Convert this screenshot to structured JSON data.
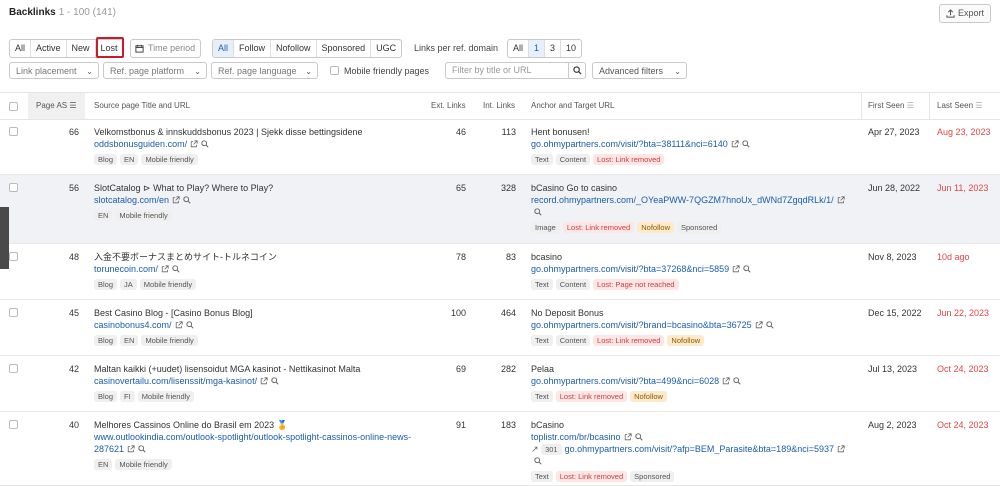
{
  "header": {
    "title": "Backlinks",
    "count": "1 - 100 (141)",
    "export_label": "Export"
  },
  "filters": {
    "status": [
      {
        "label": "All",
        "sel": false
      },
      {
        "label": "Active",
        "sel": false
      },
      {
        "label": "New",
        "sel": false
      },
      {
        "label": "Lost",
        "sel": false
      }
    ],
    "time_period": "Time period",
    "follow": [
      {
        "label": "All",
        "sel": true
      },
      {
        "label": "Follow",
        "sel": false
      },
      {
        "label": "Nofollow",
        "sel": false
      },
      {
        "label": "Sponsored",
        "sel": false
      },
      {
        "label": "UGC",
        "sel": false
      }
    ],
    "links_per_domain_label": "Links per ref. domain",
    "links_per_domain": [
      {
        "label": "All",
        "sel": false
      },
      {
        "label": "1",
        "sel": true
      },
      {
        "label": "3",
        "sel": false
      },
      {
        "label": "10",
        "sel": false
      }
    ],
    "link_placement": "Link placement",
    "ref_page_platform": "Ref. page platform",
    "ref_page_language": "Ref. page language",
    "mobile_friendly_pages": "Mobile friendly pages",
    "search_placeholder": "Filter by title or URL",
    "advanced_filters": "Advanced filters"
  },
  "columns": {
    "page_as": "Page AS",
    "source": "Source page Title and URL",
    "ext": "Ext. Links",
    "int": "Int. Links",
    "anchor": "Anchor and Target URL",
    "first_seen": "First Seen",
    "last_seen": "Last Seen"
  },
  "rows": [
    {
      "as": "66",
      "title": "Velkomstbonus & innskuddsbonus 2023 | Sjekk disse bettingsidene",
      "url": "oddsbonusguiden.com/",
      "tags": [
        "Blog",
        "EN",
        "Mobile friendly"
      ],
      "ext": "46",
      "int": "113",
      "anchor": "Hent bonusen!",
      "target": "go.ohmypartners.com/visit/?bta=38111&nci=6140",
      "atags": [
        {
          "t": "Text",
          "k": ""
        },
        {
          "t": "Content",
          "k": ""
        },
        {
          "t": "Lost: Link removed",
          "k": "lost"
        }
      ],
      "first": "Apr 27, 2023",
      "last": "Aug 23, 2023"
    },
    {
      "as": "56",
      "title": "SlotCatalog ⊳ What to Play? Where to Play?",
      "url": "slotcatalog.com/en",
      "tags": [
        "EN",
        "Mobile friendly"
      ],
      "ext": "65",
      "int": "328",
      "anchor": "bCasino Go to casino",
      "target": "record.ohmypartners.com/_OYeaPWW-7QGZM7hnoUx_dWNd7ZgqdRLk/1/",
      "atags": [
        {
          "t": "Image",
          "k": ""
        },
        {
          "t": "Lost: Link removed",
          "k": "lost"
        },
        {
          "t": "Nofollow",
          "k": "nf"
        },
        {
          "t": "Sponsored",
          "k": ""
        }
      ],
      "first": "Jun 28, 2022",
      "last": "Jun 11, 2023"
    },
    {
      "as": "48",
      "title": "入金不要ボーナスまとめサイト-トルネコイン",
      "url": "torunecoin.com/",
      "tags": [
        "Blog",
        "JA",
        "Mobile friendly"
      ],
      "ext": "78",
      "int": "83",
      "anchor": "bcasino",
      "target": "go.ohmypartners.com/visit/?bta=37268&nci=5859",
      "atags": [
        {
          "t": "Text",
          "k": ""
        },
        {
          "t": "Content",
          "k": ""
        },
        {
          "t": "Lost: Page not reached",
          "k": "lost"
        }
      ],
      "first": "Nov 8, 2023",
      "last": "10d ago"
    },
    {
      "as": "45",
      "title": "Best Casino Blog - [Casino Bonus Blog]",
      "url": "casinobonus4.com/",
      "tags": [
        "Blog",
        "EN",
        "Mobile friendly"
      ],
      "ext": "100",
      "int": "464",
      "anchor": "No Deposit Bonus",
      "target": "go.ohmypartners.com/visit/?brand=bcasino&bta=36725",
      "atags": [
        {
          "t": "Text",
          "k": ""
        },
        {
          "t": "Content",
          "k": ""
        },
        {
          "t": "Lost: Link removed",
          "k": "lost"
        },
        {
          "t": "Nofollow",
          "k": "nf"
        }
      ],
      "first": "Dec 15, 2022",
      "last": "Jun 22, 2023"
    },
    {
      "as": "42",
      "title": "Maltan kaikki (+uudet) lisensoidut MGA kasinot - Nettikasinot Malta",
      "url": "casinovertailu.com/lisenssit/mga-kasinot/",
      "tags": [
        "Blog",
        "FI",
        "Mobile friendly"
      ],
      "ext": "69",
      "int": "282",
      "anchor": "Pelaa",
      "target": "go.ohmypartners.com/visit/?bta=499&nci=6028",
      "atags": [
        {
          "t": "Text",
          "k": ""
        },
        {
          "t": "Lost: Link removed",
          "k": "lost"
        },
        {
          "t": "Nofollow",
          "k": "nf"
        }
      ],
      "first": "Jul 13, 2023",
      "last": "Oct 24, 2023"
    },
    {
      "as": "40",
      "title": "Melhores Cassinos Online do Brasil em 2023 🏅",
      "url": "www.outlookindia.com/outlook-spotlight/outlook-spotlight-cassinos-online-news-287621",
      "tags": [
        "EN",
        "Mobile friendly"
      ],
      "ext": "91",
      "int": "183",
      "anchor": "bCasino",
      "target": "toplistr.com/br/bcasino",
      "redirect_code": "301",
      "redirect_target": "go.ohmypartners.com/visit/?afp=BEM_Parasite&bta=189&nci=5937",
      "atags": [
        {
          "t": "Text",
          "k": ""
        },
        {
          "t": "Lost: Link removed",
          "k": "lost"
        },
        {
          "t": "Sponsored",
          "k": ""
        }
      ],
      "first": "Aug 2, 2023",
      "last": "Oct 24, 2023"
    }
  ]
}
